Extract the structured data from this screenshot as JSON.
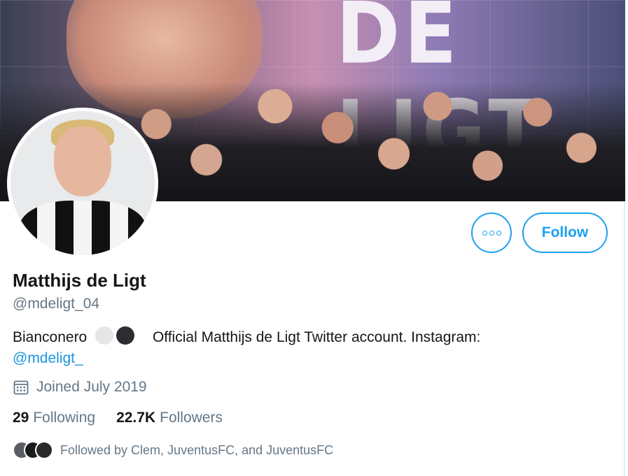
{
  "banner": {
    "text": "DE LIGT",
    "image": "group-photo-banner"
  },
  "profile": {
    "avatar": "profile-photo-avatar",
    "name": "Matthijs de Ligt",
    "handle": "@mdeligt_04",
    "bio_prefix": "Bianconero",
    "bio_text": "Official Matthijs de Ligt Twitter account. Instagram:",
    "bio_link": "@mdeligt_",
    "emoji_colors": [
      "#e6e6e8",
      "#2b2d30"
    ],
    "joined": "Joined July 2019",
    "joined_icon": "calendar-icon"
  },
  "actions": {
    "more_icon": "more-options-icon",
    "follow_label": "Follow"
  },
  "stats": {
    "following_count": "29",
    "following_label": "Following",
    "followers_count": "22.7K",
    "followers_label": "Followers"
  },
  "followed_by": {
    "text": "Followed by Clem, JuventusFC, and JuventusFC",
    "avatars": [
      "#5a5d63",
      "#1a1a1a",
      "#2a2a2a"
    ]
  },
  "colors": {
    "accent": "#1da1f2",
    "link": "#1b95e0",
    "text_primary": "#14171a",
    "text_secondary": "#657786"
  }
}
